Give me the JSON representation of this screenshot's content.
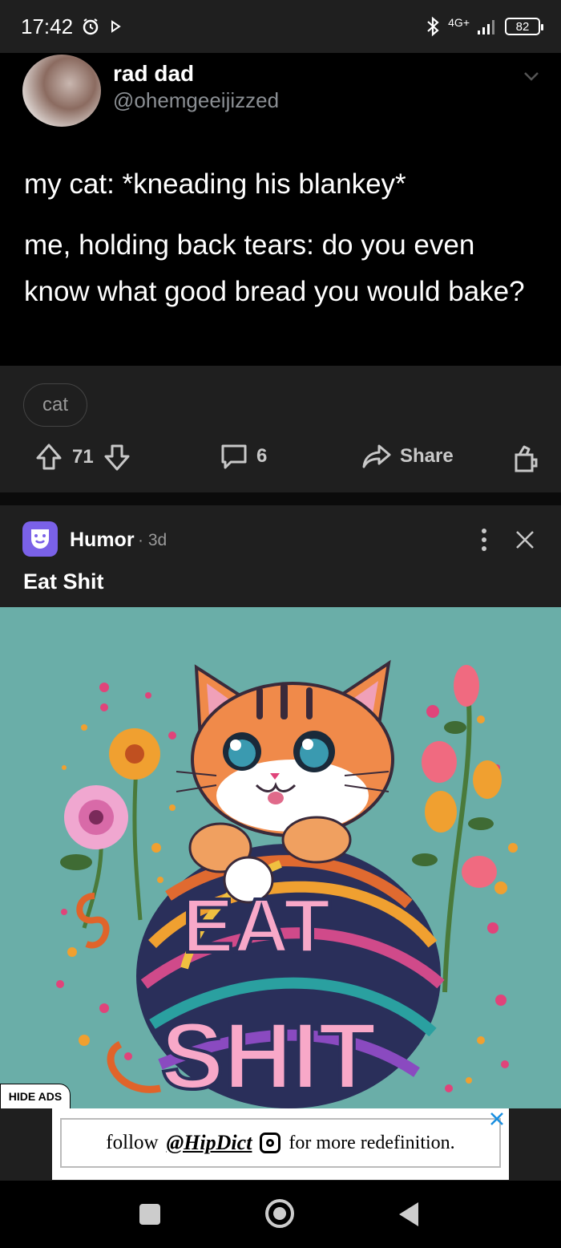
{
  "status_bar": {
    "time": "17:42",
    "network": "4G+",
    "battery": "82",
    "icons": [
      "alarm-icon",
      "play-icon",
      "bluetooth-icon",
      "signal-icon",
      "battery-icon"
    ]
  },
  "tweet": {
    "name": "rad dad",
    "handle": "@ohemgeeijizzed",
    "line1": "my cat: *kneading his blankey*",
    "line2": "me, holding back tears: do you even know what good bread you would bake?"
  },
  "post": {
    "flair": "cat",
    "upvotes": "71",
    "comments": "6",
    "share_label": "Share"
  },
  "ad": {
    "community": "Humor",
    "separator": "·",
    "age": "3d",
    "title": "Eat Shit",
    "art_text_1": "EAT",
    "art_text_2": "SHIT",
    "accent": "#7a61e8"
  },
  "banner": {
    "hide_ads_label": "HIDE ADS",
    "follow": "follow",
    "handle": "@HipDict",
    "tail": "for more redefinition."
  }
}
